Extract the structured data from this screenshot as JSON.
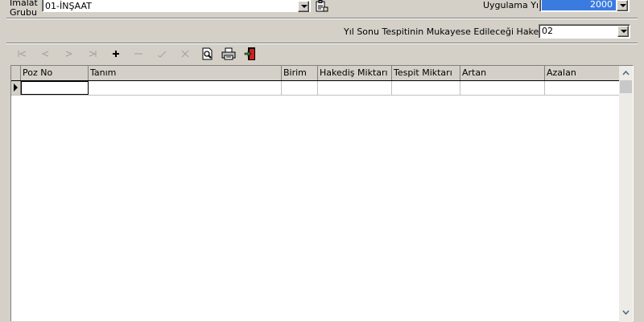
{
  "form": {
    "imalat_label": "İmalat\nGrubu",
    "imalat_value": "01-İNŞAAT",
    "uygulama_label": "Uygulama Yılı",
    "uygulama_value": "2000",
    "hakedis_label": "Yıl Sonu Tespitinin Mukayese Edileceği Hakediş No",
    "hakedis_value": "02"
  },
  "toolbar": {
    "buttons": [
      {
        "name": "first-record-button",
        "icon": "first-icon"
      },
      {
        "name": "prior-record-button",
        "icon": "prior-icon"
      },
      {
        "name": "next-record-button",
        "icon": "next-icon"
      },
      {
        "name": "last-record-button",
        "icon": "last-icon"
      },
      {
        "name": "insert-record-button",
        "icon": "plus-icon"
      },
      {
        "name": "delete-record-button",
        "icon": "minus-icon"
      },
      {
        "name": "post-record-button",
        "icon": "check-icon"
      },
      {
        "name": "cancel-record-button",
        "icon": "x-icon"
      },
      {
        "name": "print-preview-button",
        "icon": "preview-icon"
      },
      {
        "name": "print-button",
        "icon": "printer-icon"
      },
      {
        "name": "exit-button",
        "icon": "exit-door-icon"
      }
    ]
  },
  "grid": {
    "columns": [
      "Poz No",
      "Tanım",
      "Birim",
      "Hakediş Miktarı",
      "Tespit Miktarı",
      "Artan",
      "Azalan"
    ],
    "rows": [
      [
        "",
        "",
        "",
        "",
        "",
        "",
        ""
      ]
    ]
  },
  "colors": {
    "face": "#d4d0c8",
    "selection": "#2a6ad3",
    "grid_bg": "#ffffff"
  }
}
